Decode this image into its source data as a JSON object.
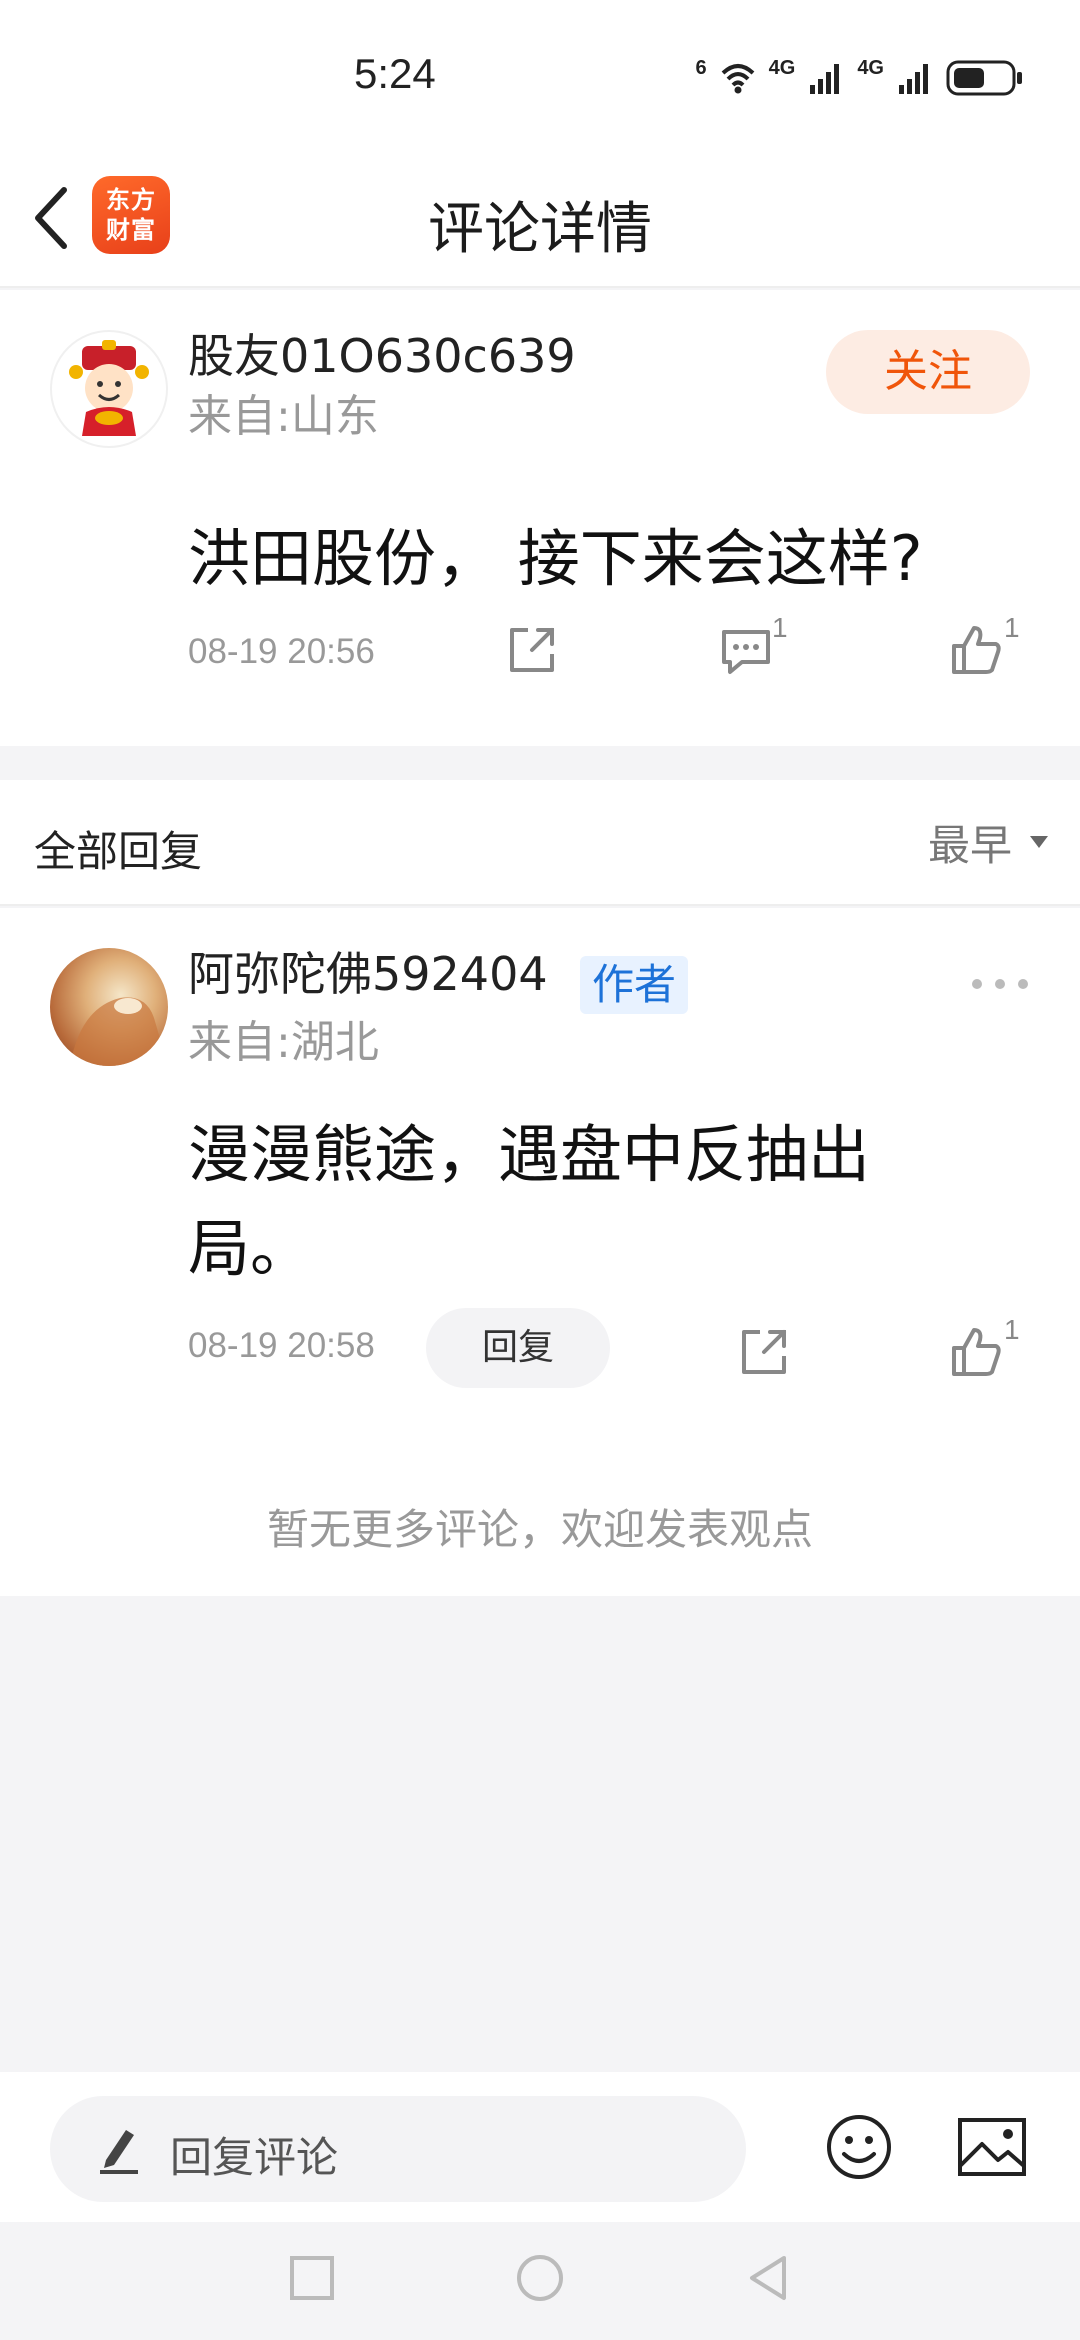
{
  "status_bar": {
    "time": "5:24",
    "wifi_label": "6",
    "net1_label": "4G",
    "net2_label": "4G"
  },
  "nav": {
    "logo_line1": "东方",
    "logo_line2": "财富",
    "title": "评论详情"
  },
  "post": {
    "username": "股友01O630c639",
    "location": "来自:山东",
    "follow_label": "关注",
    "content": "洪田股份， 接下来会这样?",
    "time": "08-19 20:56",
    "comment_count": "1",
    "like_count": "1"
  },
  "replies_header": {
    "title": "全部回复",
    "sort_label": "最早"
  },
  "reply": {
    "username": "阿弥陀佛592404",
    "author_tag": "作者",
    "location": "来自:湖北",
    "content": "漫漫熊途，遇盘中反抽出局。",
    "time": "08-19 20:58",
    "reply_label": "回复",
    "like_count": "1"
  },
  "no_more_text": "暂无更多评论，欢迎发表观点",
  "bottom_bar": {
    "placeholder": "回复评论"
  },
  "colors": {
    "brand_orange": "#f0550a",
    "author_blue": "#1d72d8",
    "background": "#f4f4f6"
  },
  "icons": [
    "back-icon",
    "share-icon",
    "comment-icon",
    "like-icon",
    "pencil-icon",
    "emoji-icon",
    "image-icon",
    "more-icon",
    "dropdown-icon"
  ]
}
